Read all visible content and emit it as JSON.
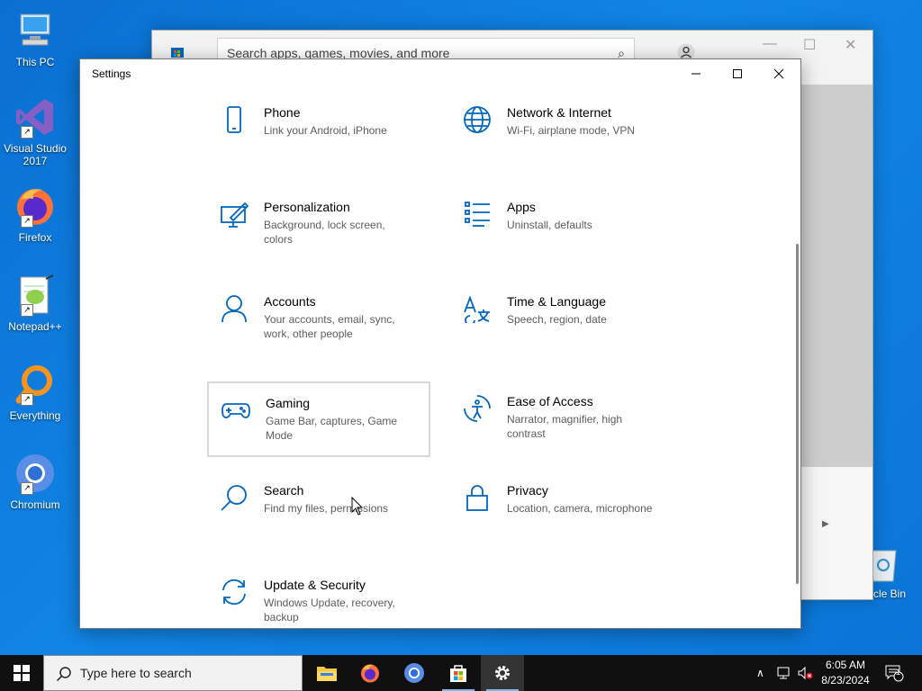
{
  "desktop": {
    "icons": [
      {
        "label": "This PC"
      },
      {
        "label": "Visual Studio 2017"
      },
      {
        "label": "Firefox"
      },
      {
        "label": "Notepad++"
      },
      {
        "label": "Everything"
      },
      {
        "label": "Chromium"
      },
      {
        "label": "Recycle Bin",
        "visible_text": "ycle Bin"
      }
    ]
  },
  "store_window": {
    "search_placeholder": "Search apps, games, movies, and more"
  },
  "settings": {
    "title": "Settings",
    "tiles": [
      {
        "name": "Phone",
        "desc": "Link your Android, iPhone",
        "icon": "phone-icon"
      },
      {
        "name": "Network & Internet",
        "desc": "Wi-Fi, airplane mode, VPN",
        "icon": "globe-icon"
      },
      {
        "name": "Personalization",
        "desc": "Background, lock screen, colors",
        "icon": "paint-icon"
      },
      {
        "name": "Apps",
        "desc": "Uninstall, defaults",
        "icon": "apps-list-icon"
      },
      {
        "name": "Accounts",
        "desc": "Your accounts, email, sync, work, other people",
        "icon": "person-icon"
      },
      {
        "name": "Time & Language",
        "desc": "Speech, region, date",
        "icon": "time-language-icon"
      },
      {
        "name": "Gaming",
        "desc": "Game Bar, captures, Game Mode",
        "icon": "gamepad-icon"
      },
      {
        "name": "Ease of Access",
        "desc": "Narrator, magnifier, high contrast",
        "icon": "ease-of-access-icon"
      },
      {
        "name": "Search",
        "desc": "Find my files, permissions",
        "icon": "search-icon"
      },
      {
        "name": "Privacy",
        "desc": "Location, camera, microphone",
        "icon": "lock-icon"
      },
      {
        "name": "Update & Security",
        "desc": "Windows Update, recovery, backup",
        "icon": "sync-icon"
      }
    ]
  },
  "taskbar": {
    "search_placeholder": "Type here to search",
    "time": "6:05 AM",
    "date": "8/23/2024",
    "notification_count": "1"
  },
  "colors": {
    "accent": "#0067c0",
    "desktop": "#0b78d8",
    "taskbar": "#101010"
  }
}
